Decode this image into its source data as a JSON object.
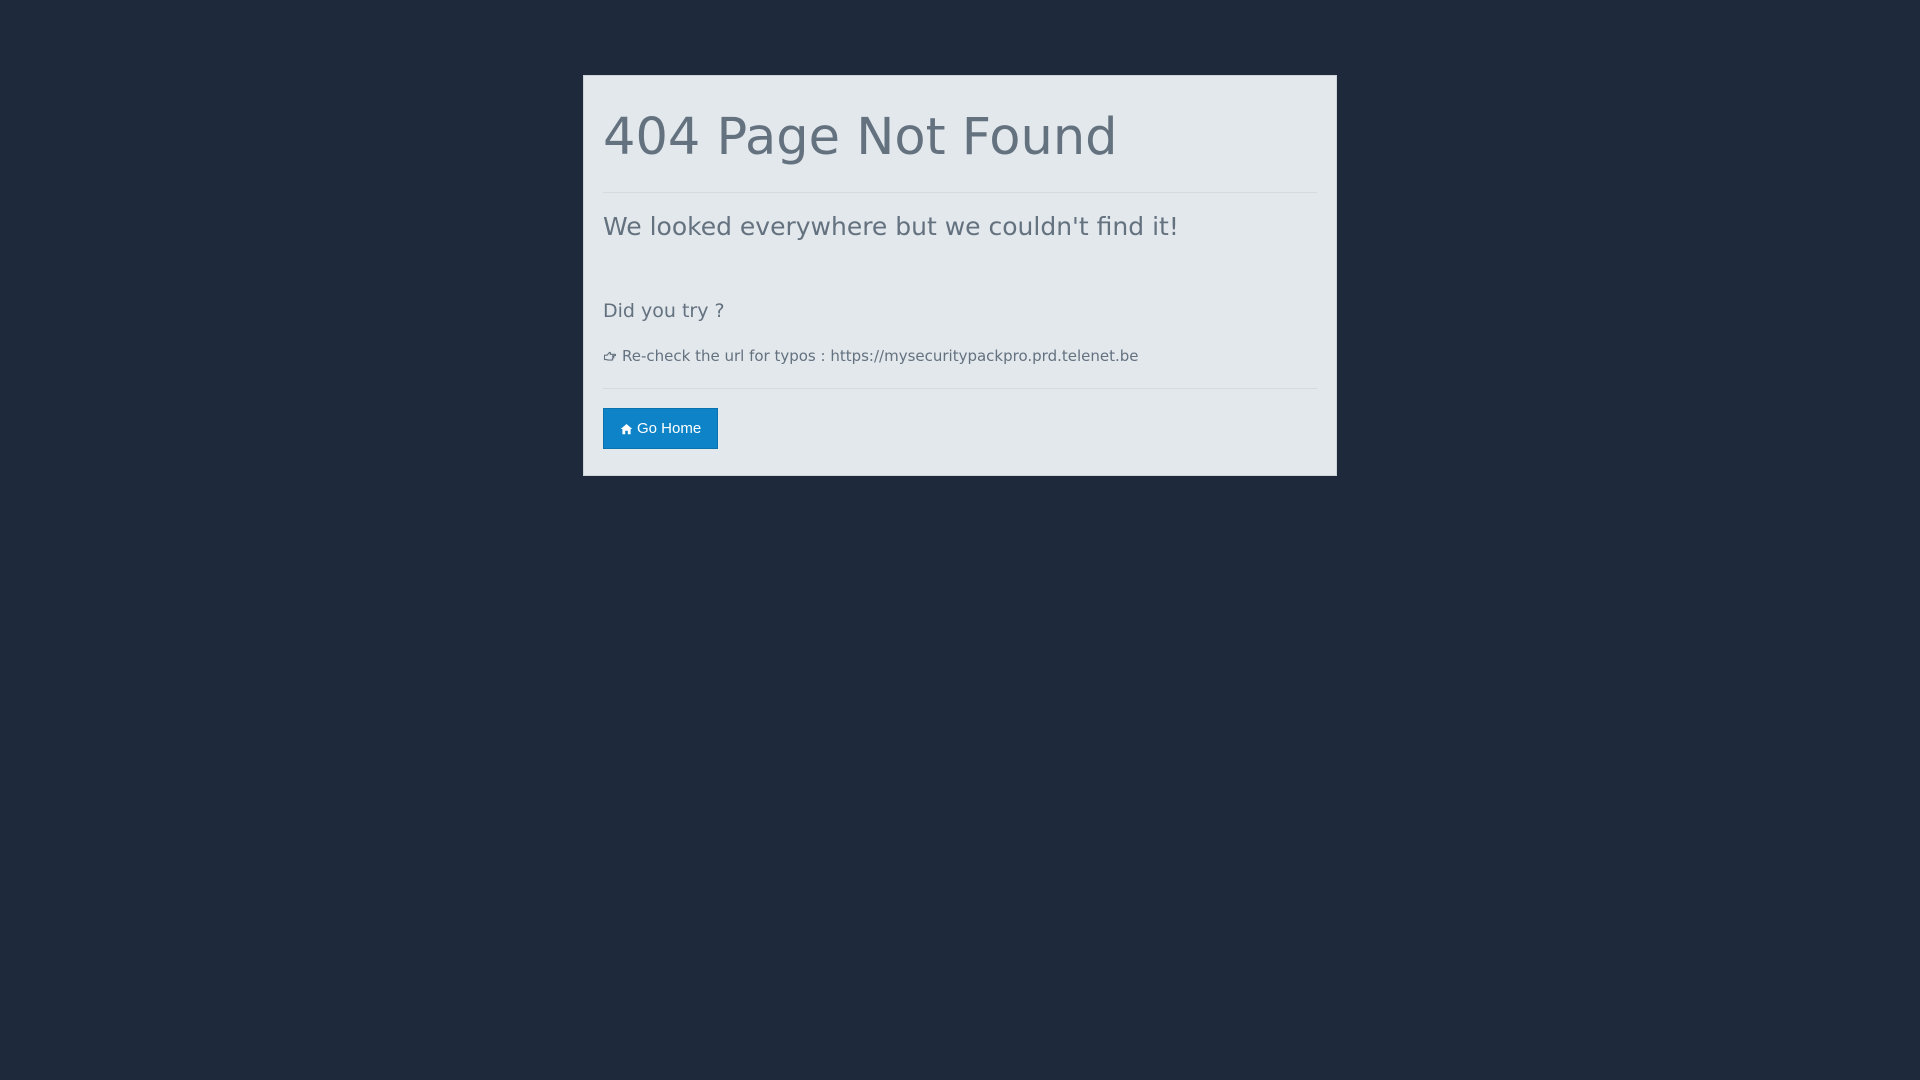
{
  "page": {
    "title": "404 Page Not Found",
    "subtitle": "We looked everywhere but we couldn't find it!",
    "try_heading": "Did you try ?",
    "tip": {
      "icon": "hand-point-right-icon",
      "text": "Re-check the url for typos : https://mysecuritypackpro.prd.telenet.be"
    },
    "home_button": {
      "icon": "home-icon",
      "label": "Go Home"
    }
  },
  "colors": {
    "background": "#1e293b",
    "card": "#e2e8ec",
    "text": "#64717f",
    "button": "#0e83c8"
  }
}
